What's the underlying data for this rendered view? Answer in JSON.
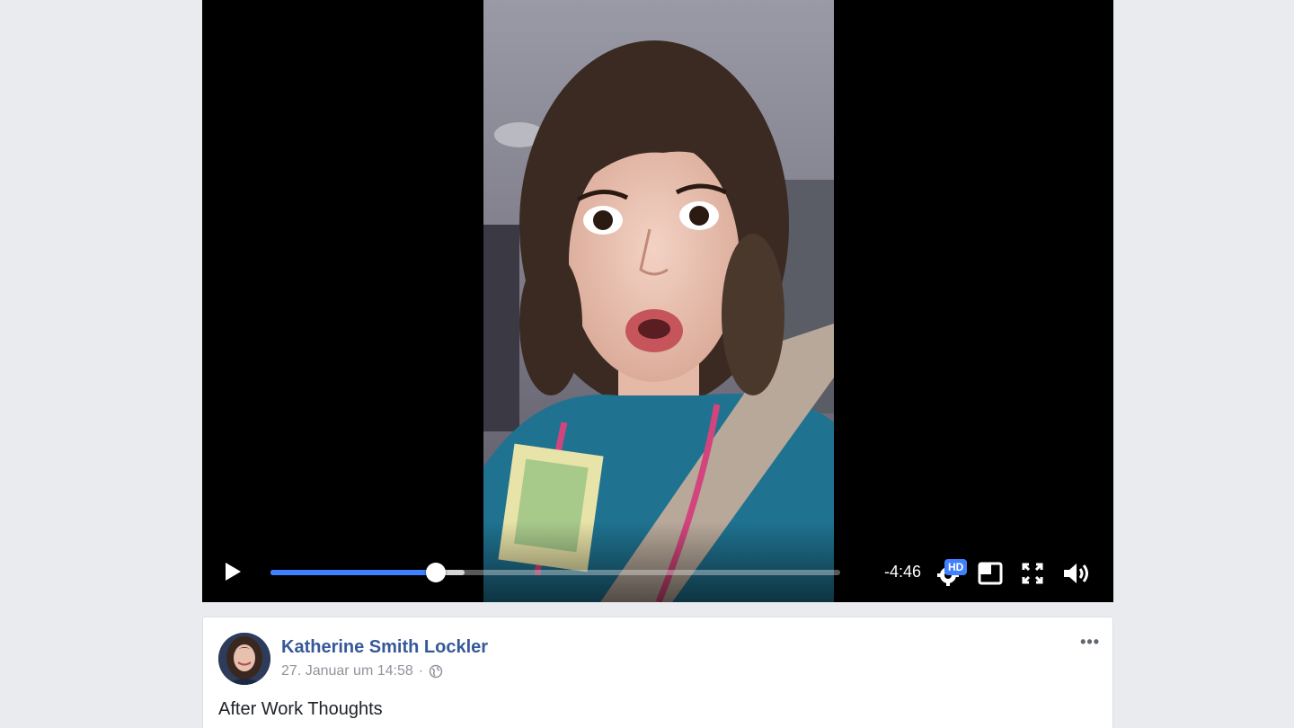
{
  "video": {
    "time_remaining": "-4:46",
    "quality_badge": "HD",
    "played_fraction": 0.29,
    "buffered_fraction": 0.34,
    "icons": {
      "play": "play-icon",
      "settings": "gear-icon",
      "pip": "picture-in-picture-icon",
      "fullscreen": "fullscreen-icon",
      "volume": "volume-icon"
    }
  },
  "post": {
    "author": "Katherine Smith Lockler",
    "timestamp": "27. Januar um 14:58",
    "separator": "·",
    "privacy_icon": "globe-icon",
    "more_label": "•••",
    "text": "After Work Thoughts"
  },
  "colors": {
    "accent": "#4080ff",
    "author_link": "#365899",
    "background": "#e9ebee"
  }
}
